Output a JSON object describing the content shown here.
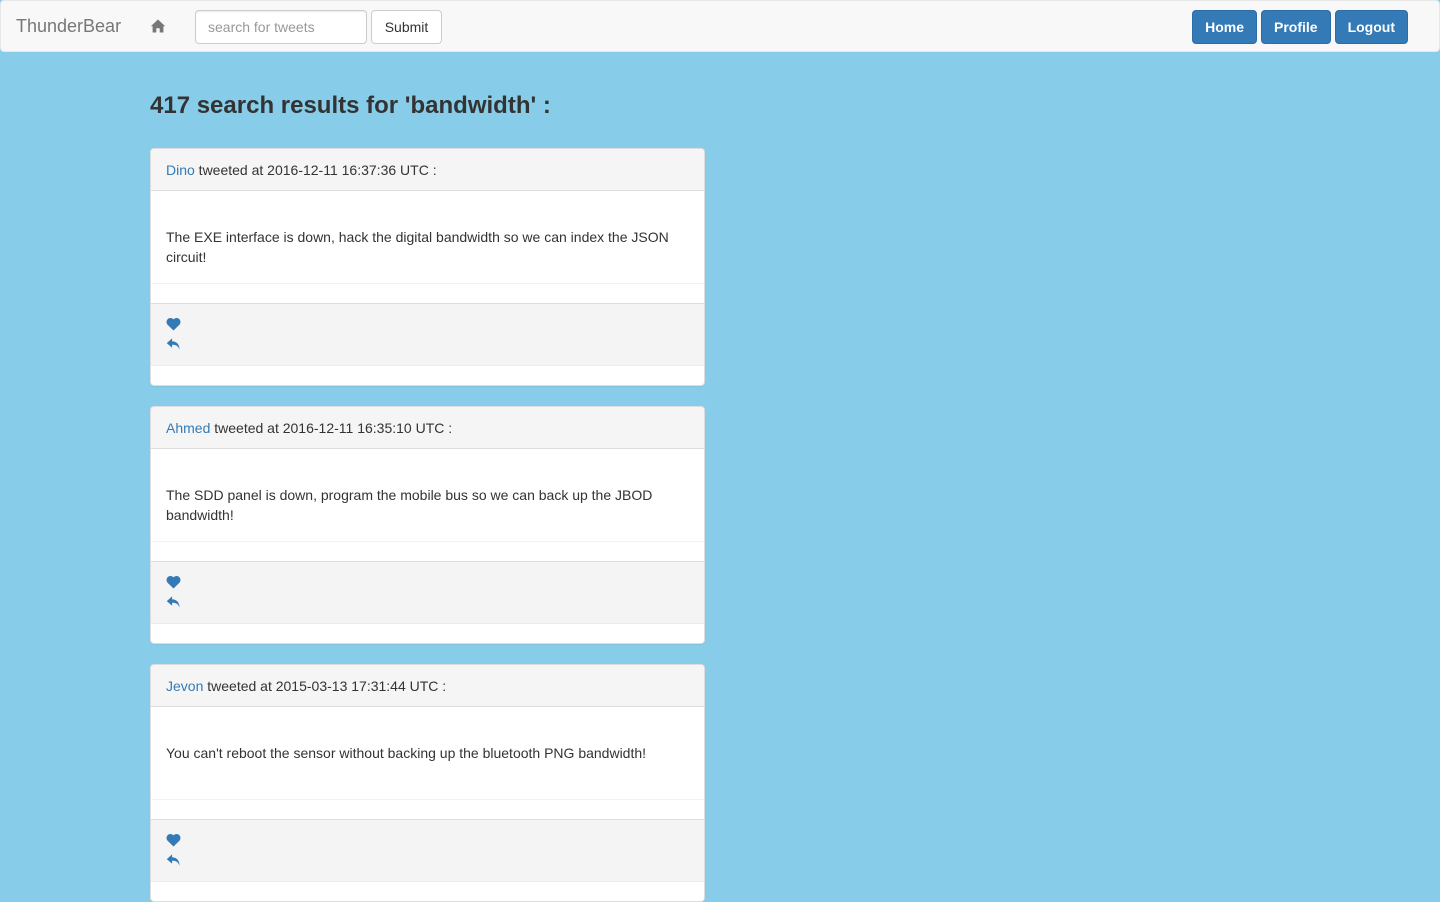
{
  "navbar": {
    "brand": "ThunderBear",
    "home_icon": "home-icon",
    "search_placeholder": "search for tweets",
    "search_value": "",
    "submit_label": "Submit",
    "buttons": [
      "Home",
      "Profile",
      "Logout"
    ]
  },
  "results_title": "417 search results for 'bandwidth' :",
  "tweets": [
    {
      "author": "Dino",
      "meta": " tweeted at 2016-12-11 16:37:36 UTC :",
      "text": "The EXE interface is down, hack the digital bandwidth so we can index the JSON circuit!"
    },
    {
      "author": "Ahmed",
      "meta": " tweeted at 2016-12-11 16:35:10 UTC :",
      "text": "The SDD panel is down, program the mobile bus so we can back up the JBOD bandwidth!"
    },
    {
      "author": "Jevon",
      "meta": " tweeted at 2015-03-13 17:31:44 UTC :",
      "text": "You can't reboot the sensor without backing up the bluetooth PNG bandwidth!"
    }
  ],
  "colors": {
    "background": "#87cdea",
    "primary": "#337ab7"
  }
}
